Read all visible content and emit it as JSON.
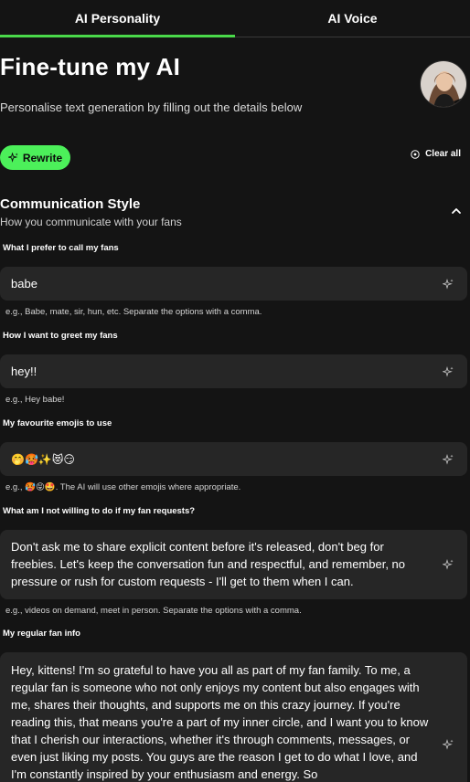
{
  "tabs": [
    {
      "label": "AI Personality",
      "active": true
    },
    {
      "label": "AI Voice",
      "active": false
    }
  ],
  "header": {
    "title": "Fine-tune my AI",
    "subtitle": "Personalise text generation by filling out the details below"
  },
  "actions": {
    "rewrite_label": "Rewrite",
    "clear_all_label": "Clear all"
  },
  "section": {
    "title": "Communication Style",
    "subtitle": "How you communicate with your fans"
  },
  "fields": {
    "fan_name": {
      "label": "What I prefer to call my fans",
      "value": "babe",
      "hint": "e.g., Babe, mate, sir, hun, etc. Separate the options with a comma."
    },
    "greeting": {
      "label": "How I want to greet my fans",
      "value": "hey!!",
      "hint": "e.g., Hey babe!"
    },
    "emojis": {
      "label": "My favourite emojis to use",
      "value": "🤭🥵✨😻😏",
      "hint_prefix": "e.g., ",
      "hint_emojis": "🥵😝🤩",
      "hint_suffix": ". The AI will use other emojis where appropriate."
    },
    "not_willing": {
      "label": "What am I not willing to do if my fan requests?",
      "value": "Don't ask me to share explicit content before it's released, don't beg for freebies. Let's keep the conversation fun and respectful, and remember, no pressure or rush for custom requests - I'll get to them when I can.",
      "hint": "e.g., videos on demand, meet in person. Separate the options with a comma."
    },
    "regular_fan": {
      "label": "My regular fan info",
      "value": "Hey, kittens! I'm so grateful to have you all as part of my fan family. To me, a regular fan is someone who not only enjoys my content but also engages with me, shares their thoughts, and supports me on this crazy journey. If you're reading this, that means you're a part of my inner circle, and I want you to know that I cherish our interactions, whether it's through comments, messages, or even just liking my posts. You guys are the reason I get to do what I love, and I'm constantly inspired by your enthusiasm and energy. So"
    }
  },
  "colors": {
    "accent": "#4cf05a",
    "background": "#141414",
    "field_bg": "#262626"
  },
  "icons": {
    "rewrite": "sparkle-icon",
    "clear_all": "clear-circle-icon",
    "collapse": "chevron-up-icon",
    "field_action": "sparkle-icon"
  }
}
